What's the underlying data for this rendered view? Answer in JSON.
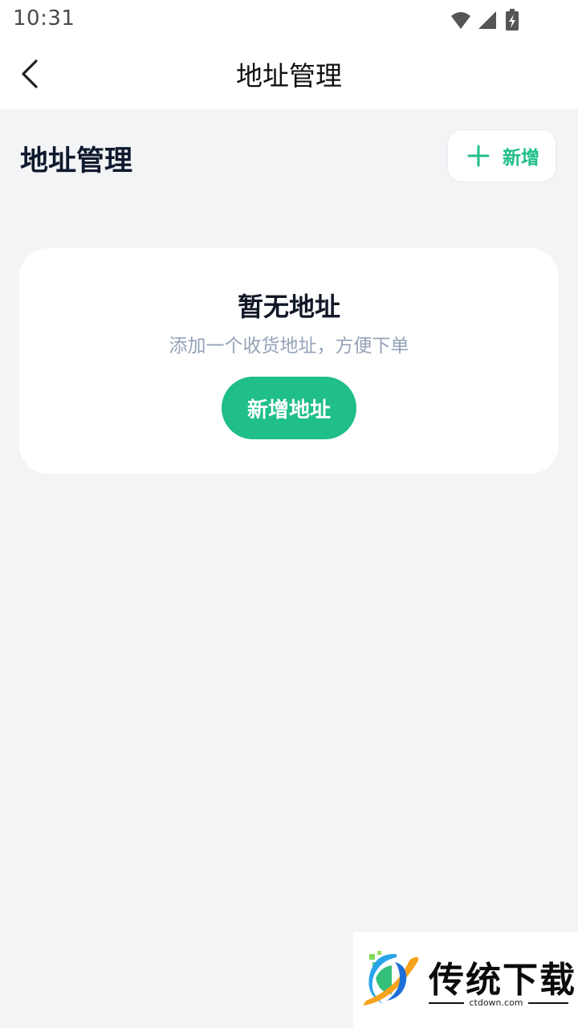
{
  "status_bar": {
    "time": "10:31"
  },
  "app_bar": {
    "title": "地址管理"
  },
  "section": {
    "title": "地址管理",
    "add_label": "新增"
  },
  "empty_state": {
    "title": "暂无地址",
    "subtitle": "添加一个收货地址，方便下单",
    "button_label": "新增地址"
  },
  "watermark": {
    "brand": "传统下载",
    "domain": "ctdown.com"
  },
  "colors": {
    "accent": "#1fbf87",
    "background": "#f3f4f6",
    "card": "#ffffff"
  }
}
